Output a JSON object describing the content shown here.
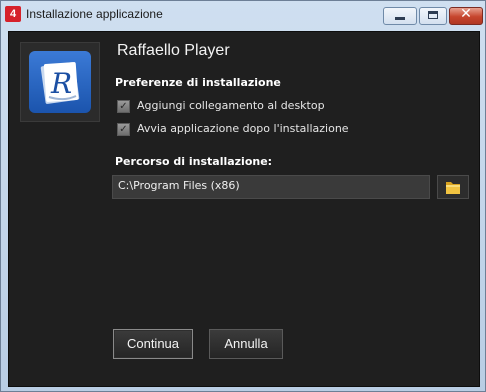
{
  "window": {
    "title": "Installazione applicazione",
    "logo_text": "4",
    "close_glyph": "✕"
  },
  "app": {
    "name": "Raffaello Player",
    "icon": "raffaello-r-book-icon",
    "icon_letter": "R"
  },
  "preferences": {
    "title": "Preferenze di installazione",
    "options": [
      {
        "label": "Aggiungi collegamento al desktop",
        "checked": true
      },
      {
        "label": "Avvia applicazione dopo l'installazione",
        "checked": true
      }
    ]
  },
  "install_path": {
    "title": "Percorso di installazione:",
    "value": "C:\\Program Files (x86)",
    "browse_icon": "folder-icon"
  },
  "buttons": {
    "continue": "Continua",
    "cancel": "Annulla"
  },
  "colors": {
    "client_background": "#1f1f1f",
    "icon_blue": "#1b54ad",
    "close_red": "#c6452d"
  }
}
